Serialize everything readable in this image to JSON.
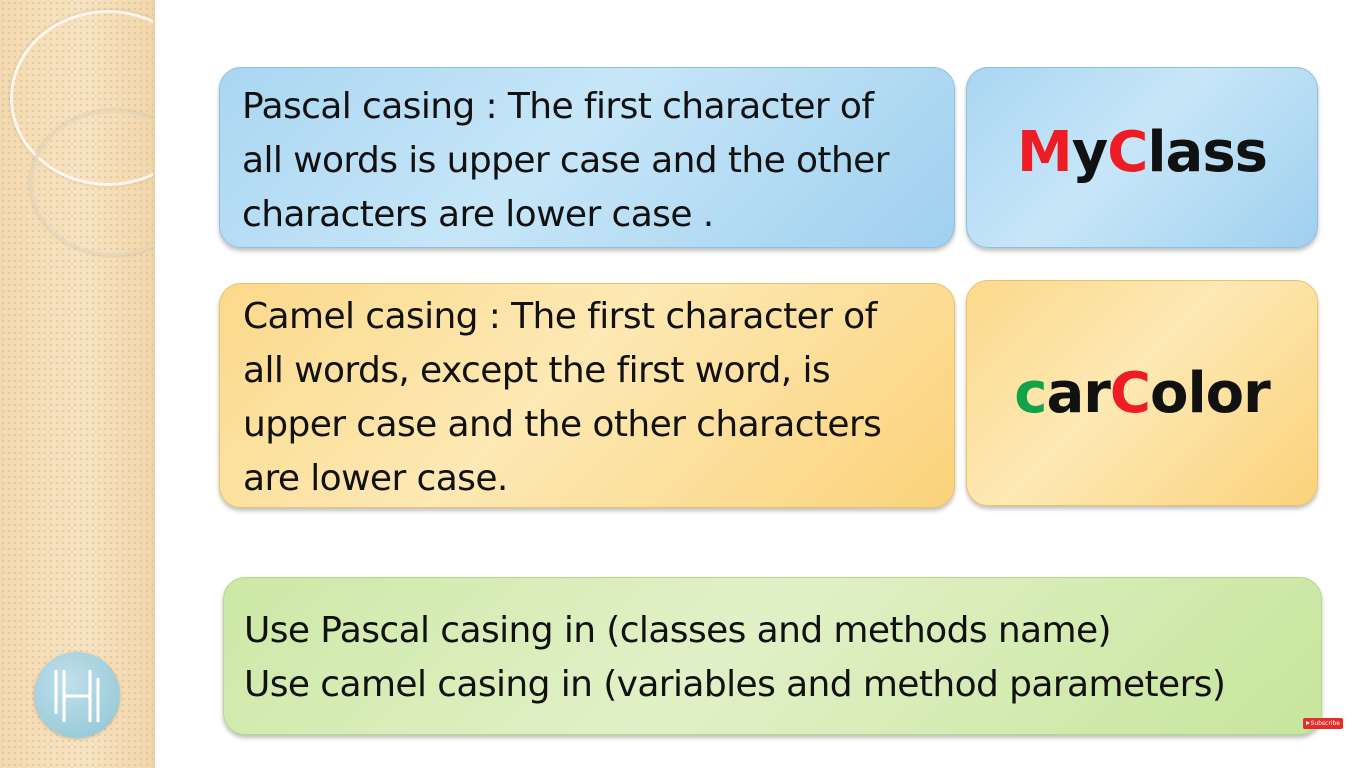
{
  "pascal": {
    "lines": [
      "Pascal casing : The first character of",
      "all words is upper case and the other",
      "characters are lower case ."
    ],
    "example": [
      {
        "text": "M",
        "color": "#ee1c25"
      },
      {
        "text": "y",
        "color": "#111111"
      },
      {
        "text": "C",
        "color": "#ee1c25"
      },
      {
        "text": "lass",
        "color": "#111111"
      }
    ]
  },
  "camel": {
    "lines": [
      "Camel casing : The first character of",
      "all words, except the first word, is",
      "upper case and the other characters",
      "are lower case."
    ],
    "example": [
      {
        "text": "c",
        "color": "#11a24a"
      },
      {
        "text": "ar",
        "color": "#111111"
      },
      {
        "text": "C",
        "color": "#ee1c25"
      },
      {
        "text": "olor",
        "color": "#111111"
      }
    ]
  },
  "usage": {
    "lines": [
      "Use Pascal casing in (classes and methods name)",
      "Use camel casing in (variables and method parameters)"
    ]
  },
  "subscribe_badge": "Subscribe",
  "colors": {
    "blue_box": "#b4dcf4",
    "yellow_box": "#fcdd95",
    "green_box": "#d6edb4"
  }
}
